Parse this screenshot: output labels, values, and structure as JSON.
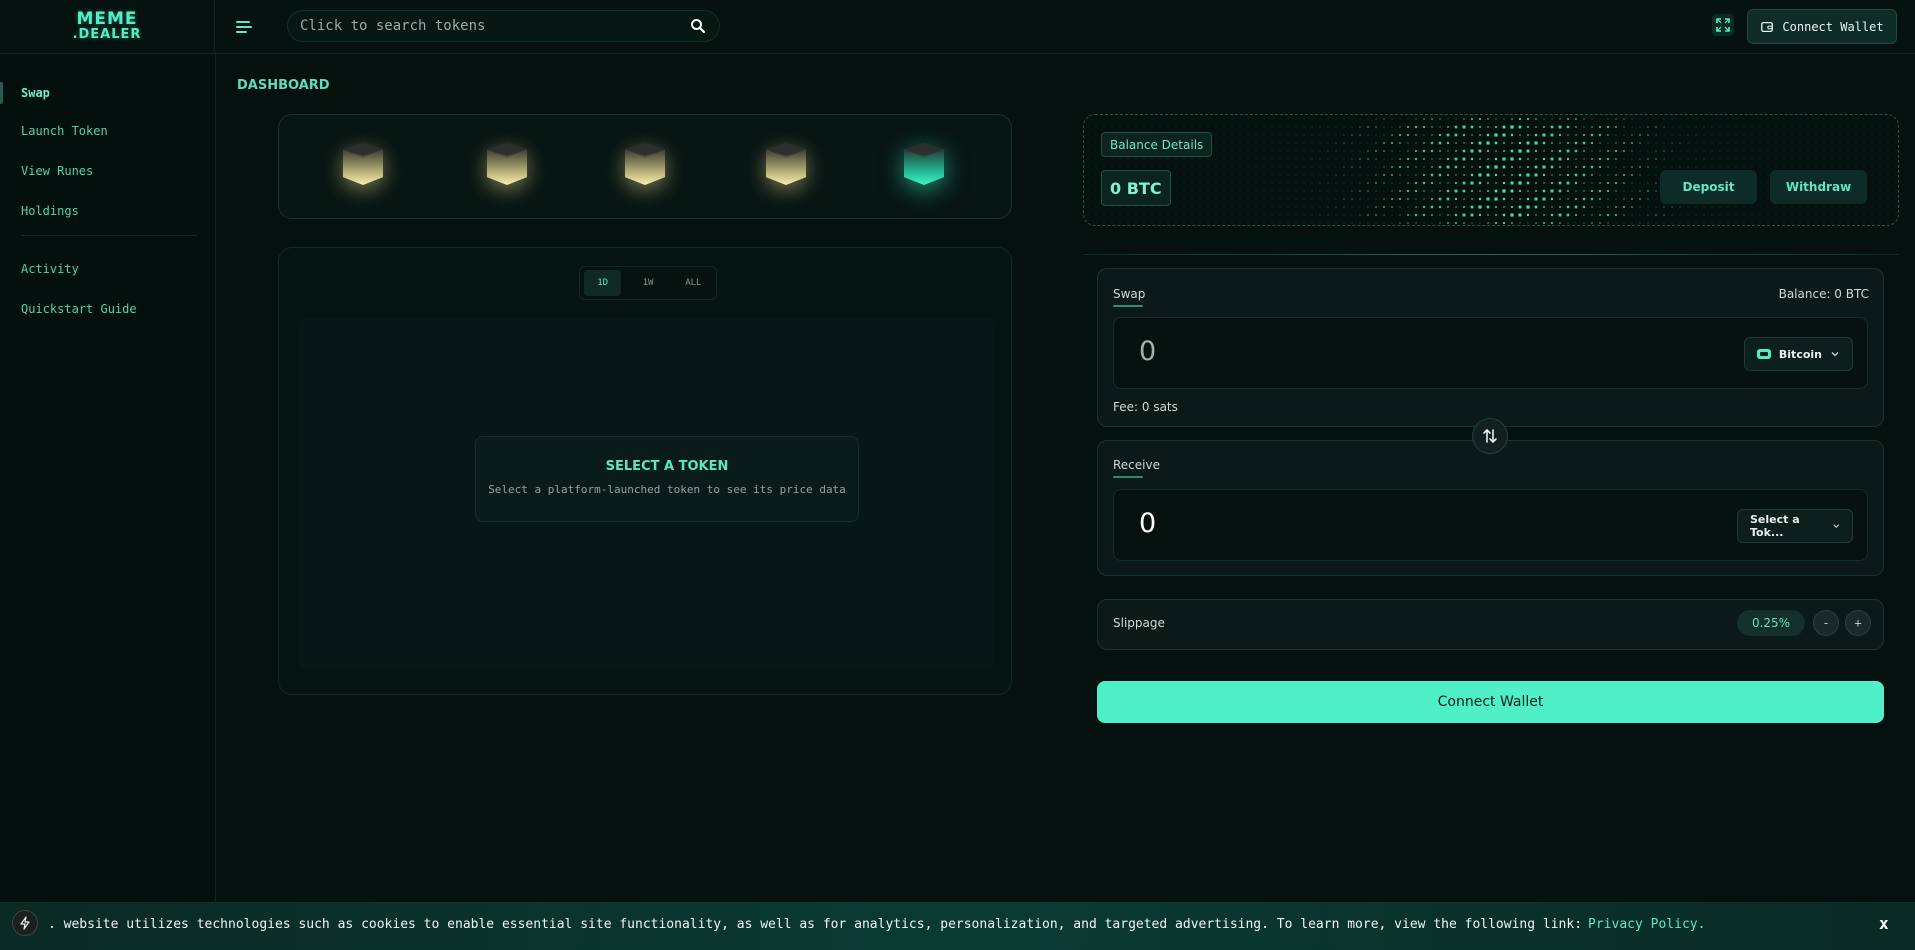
{
  "header": {
    "logo_line1": "MEME",
    "logo_line2": ".DEALER",
    "search_placeholder": "Click to search tokens",
    "connect_label": "Connect Wallet"
  },
  "sidebar": {
    "items": [
      {
        "label": "Swap"
      },
      {
        "label": "Launch Token"
      },
      {
        "label": "View Runes"
      },
      {
        "label": "Holdings"
      },
      {
        "label": "Activity"
      },
      {
        "label": "Quickstart Guide"
      }
    ]
  },
  "main": {
    "title": "DASHBOARD",
    "range_tabs": [
      "1D",
      "1W",
      "ALL"
    ],
    "select_title": "SELECT A TOKEN",
    "select_sub": "Select a platform-launched token to see its price data"
  },
  "balance": {
    "label": "Balance Details",
    "value": "0 BTC",
    "deposit": "Deposit",
    "withdraw": "Withdraw"
  },
  "swap": {
    "label": "Swap",
    "balance": "Balance: 0  BTC",
    "amount": "0",
    "token": "Bitcoin",
    "fee": "Fee: 0 sats"
  },
  "receive": {
    "label": "Receive",
    "amount": "0",
    "token": "Select a Tok..."
  },
  "slippage": {
    "label": "Slippage",
    "value": "0.25%",
    "minus": "-",
    "plus": "+"
  },
  "connect_main": "Connect Wallet",
  "cookie": {
    "text": ". website utilizes technologies such as cookies to enable essential site functionality, as well as for analytics, personalization, and targeted advertising. To learn more, view the following link:",
    "link": "Privacy Policy.",
    "close": "x"
  },
  "colors": {
    "accent": "#4ff0c8",
    "background": "#04110f",
    "panel": "#0b1a18"
  }
}
